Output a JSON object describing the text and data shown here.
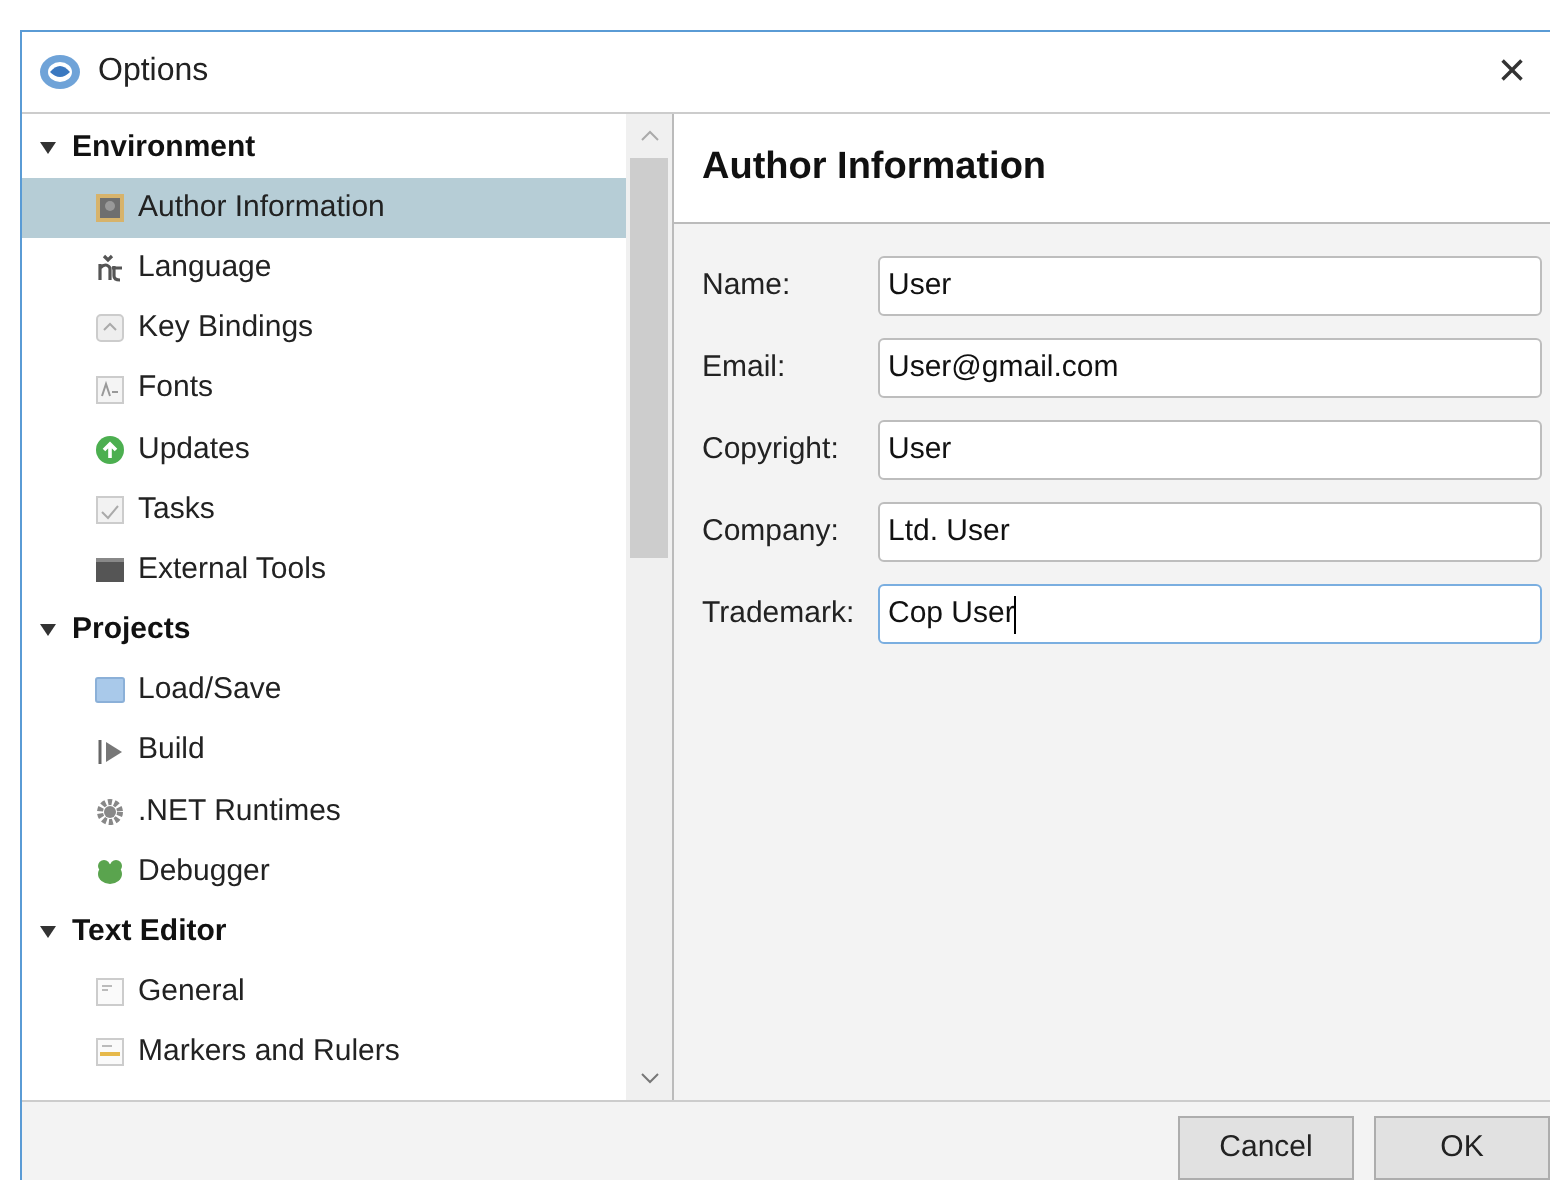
{
  "window": {
    "title": "Options",
    "close": "×"
  },
  "sidebar": {
    "groups": [
      {
        "label": "Environment",
        "expanded": true,
        "children": [
          {
            "label": "Author Information",
            "selected": true
          },
          {
            "label": "Language",
            "selected": false
          },
          {
            "label": "Key Bindings",
            "selected": false
          },
          {
            "label": "Fonts",
            "selected": false
          },
          {
            "label": "Updates",
            "selected": false
          },
          {
            "label": "Tasks",
            "selected": false
          },
          {
            "label": "External Tools",
            "selected": false
          }
        ]
      },
      {
        "label": "Projects",
        "expanded": true,
        "children": [
          {
            "label": "Load/Save",
            "selected": false
          },
          {
            "label": "Build",
            "selected": false
          },
          {
            "label": ".NET Runtimes",
            "selected": false
          },
          {
            "label": "Debugger",
            "selected": false
          }
        ]
      },
      {
        "label": "Text Editor",
        "expanded": true,
        "children": [
          {
            "label": "General",
            "selected": false
          },
          {
            "label": "Markers and Rulers",
            "selected": false
          }
        ]
      }
    ]
  },
  "panel": {
    "title": "Author Information",
    "fields": [
      {
        "label": "Name:",
        "value": "User",
        "focused": false
      },
      {
        "label": "Email:",
        "value": "User@gmail.com",
        "focused": false
      },
      {
        "label": "Copyright:",
        "value": "User",
        "focused": false
      },
      {
        "label": "Company:",
        "value": "Ltd. User",
        "focused": false
      },
      {
        "label": "Trademark:",
        "value": "Cop User",
        "focused": true
      }
    ]
  },
  "buttons": [
    "Cancel",
    "OK"
  ]
}
